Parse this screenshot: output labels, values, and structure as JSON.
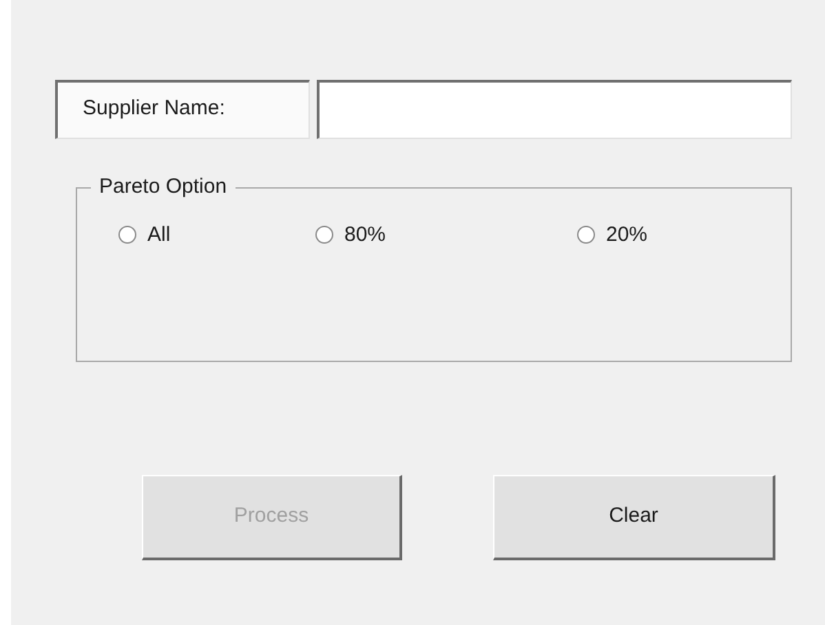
{
  "supplier": {
    "label": "Supplier Name:"
  },
  "pareto": {
    "title": "Pareto Option",
    "options": [
      {
        "label": "All",
        "selected": false
      },
      {
        "label": "80%",
        "selected": false
      },
      {
        "label": "20%",
        "selected": false
      }
    ]
  },
  "buttons": [
    {
      "label": "Process",
      "disabled": true
    },
    {
      "label": "Clear",
      "disabled": false
    }
  ]
}
